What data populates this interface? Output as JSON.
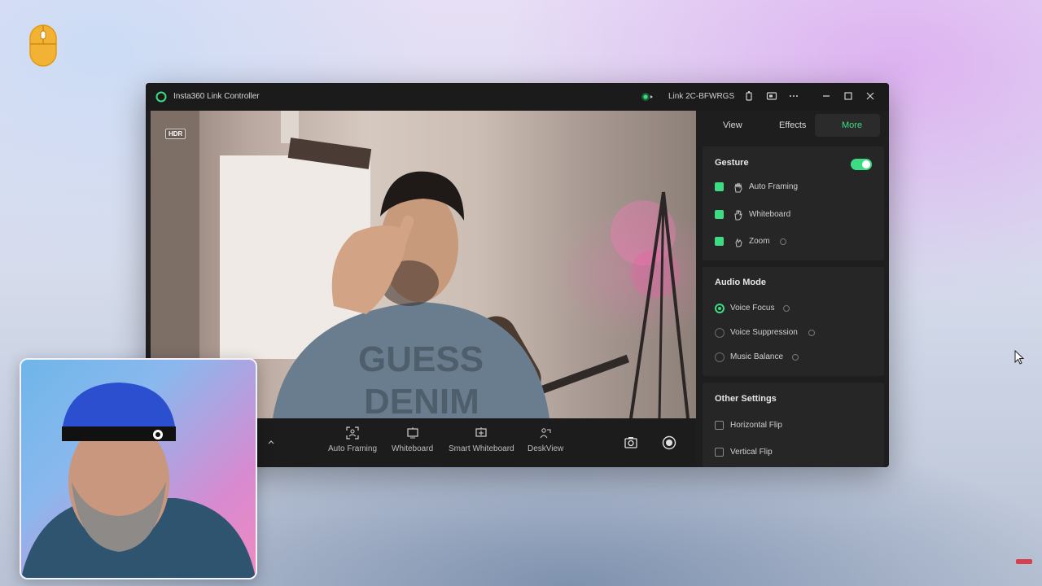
{
  "colors": {
    "accent": "#3ddc84",
    "window_bg": "#1e1e1e",
    "panel_section_bg": "#262626"
  },
  "window": {
    "title": "Insta360 Link Controller",
    "device_name": "Link 2C-BFWRGS",
    "icons": [
      "status-connected-icon",
      "battery-icon",
      "screen-icon",
      "more-icon",
      "minimize-icon",
      "maximize-icon",
      "close-icon"
    ]
  },
  "video": {
    "hdr_badge": "HDR"
  },
  "bottombar": {
    "tools": [
      {
        "label": "Auto Framing",
        "icon": "auto-framing-icon"
      },
      {
        "label": "Whiteboard",
        "icon": "whiteboard-icon"
      },
      {
        "label": "Smart Whiteboard",
        "icon": "smart-whiteboard-icon"
      },
      {
        "label": "DeskView",
        "icon": "deskview-icon"
      }
    ],
    "actions": [
      "snapshot-icon",
      "record-icon"
    ]
  },
  "panel": {
    "tabs": [
      {
        "label": "View"
      },
      {
        "label": "Effects"
      },
      {
        "label": "More",
        "active": true
      }
    ],
    "gesture": {
      "title": "Gesture",
      "enabled": true,
      "items": [
        {
          "label": "Auto Framing",
          "checked": true
        },
        {
          "label": "Whiteboard",
          "checked": true
        },
        {
          "label": "Zoom",
          "checked": true
        }
      ]
    },
    "audio": {
      "title": "Audio Mode",
      "items": [
        {
          "label": "Voice Focus",
          "selected": true
        },
        {
          "label": "Voice Suppression",
          "selected": false
        },
        {
          "label": "Music Balance",
          "selected": false
        }
      ]
    },
    "other": {
      "title": "Other Settings",
      "items": [
        {
          "label": "Horizontal Flip",
          "checked": false
        },
        {
          "label": "Vertical Flip",
          "checked": false
        }
      ]
    }
  }
}
